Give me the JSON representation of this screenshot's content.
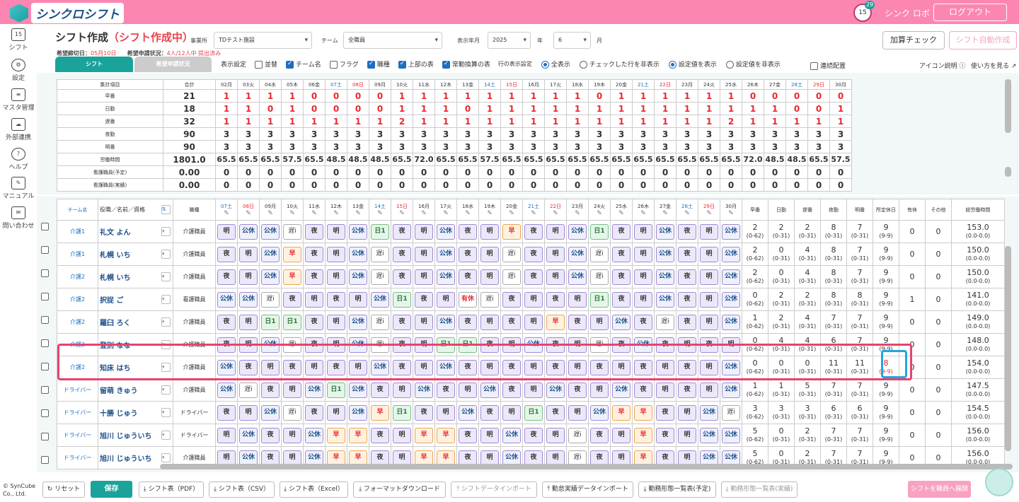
{
  "header": {
    "brand": "シンクロシフト",
    "calendar_badge": "29",
    "calendar_day": "15",
    "user": "シンク ロボ",
    "logout": "ログアウト"
  },
  "sidebar": [
    {
      "label": "シフト",
      "icon": "calendar-icon",
      "glyph": "15"
    },
    {
      "label": "設定",
      "icon": "gear-icon",
      "glyph": "⚙"
    },
    {
      "label": "マスタ管理",
      "icon": "database-icon",
      "glyph": "≡"
    },
    {
      "label": "外部連携",
      "icon": "cloud-sync-icon",
      "glyph": "☁"
    },
    {
      "label": "ヘルプ",
      "icon": "help-icon",
      "glyph": "?"
    },
    {
      "label": "マニュアル",
      "icon": "manual-icon",
      "glyph": "✎"
    },
    {
      "label": "問い合わせ",
      "icon": "mail-icon",
      "glyph": "✉"
    }
  ],
  "page": {
    "title": "シフト作成",
    "status": "（シフト作成中）",
    "deadline_label": "希望締切日：",
    "deadline": "05月10日",
    "req_label": "希望申請状況：",
    "req": "4人/12人中 提出済み"
  },
  "filters": {
    "office_label": "事業所",
    "office": "TDテスト施設",
    "team_label": "チーム",
    "team": "全職員",
    "ym_label": "表示年月",
    "year": "2025",
    "year_suffix": "年",
    "month": "6",
    "month_suffix": "月"
  },
  "actions": {
    "check": "加算チェック",
    "auto": "シフト自動作成"
  },
  "tabs": {
    "shift": "シフト",
    "request": "希望申請状況"
  },
  "display": {
    "label": "表示設定",
    "items": [
      {
        "t": "並替",
        "on": false
      },
      {
        "t": "チーム名",
        "on": true
      },
      {
        "t": "フラグ",
        "on": false
      },
      {
        "t": "職種",
        "on": true
      },
      {
        "t": "上部の表",
        "on": true
      },
      {
        "t": "常勤換算の表",
        "on": true
      }
    ],
    "row_label": "行の表示設定",
    "r1": "全表示",
    "r2": "チェックした行を非表示",
    "r3": "設定値を表示",
    "r4": "設定値を非表示",
    "consecutive": "連続配置",
    "icon_help": "アイコン説明",
    "how_to": "使い方を見る"
  },
  "summary": {
    "head_name": "集計項目",
    "head_total": "合計",
    "days": [
      "02月",
      "03火",
      "04水",
      "05木",
      "06金",
      "07土",
      "08日",
      "09月",
      "10火",
      "11水",
      "12木",
      "13金",
      "14土",
      "15日",
      "16月",
      "17火",
      "18水",
      "19木",
      "20金",
      "21土",
      "22日",
      "23月",
      "24火",
      "25水",
      "26木",
      "27金",
      "28土",
      "29日",
      "30月"
    ],
    "rows": [
      {
        "name": "早番",
        "total": "21",
        "v": [
          "1",
          "1",
          "1",
          "1",
          "0",
          "0",
          "0",
          "0",
          "1",
          "1",
          "1",
          "1",
          "1",
          "1",
          "1",
          "1",
          "1",
          "0",
          "1",
          "1",
          "1",
          "1",
          "1",
          "1",
          "0",
          "0",
          "0",
          "0",
          "0"
        ]
      },
      {
        "name": "日勤",
        "total": "18",
        "v": [
          "1",
          "1",
          "0",
          "1",
          "0",
          "0",
          "0",
          "0",
          "1",
          "1",
          "1",
          "0",
          "1",
          "1",
          "1",
          "1",
          "1",
          "1",
          "1",
          "1",
          "1",
          "1",
          "1",
          "1",
          "1",
          "1",
          "0",
          "0",
          "1"
        ]
      },
      {
        "name": "遅番",
        "total": "32",
        "v": [
          "1",
          "1",
          "1",
          "1",
          "1",
          "1",
          "1",
          "1",
          "2",
          "1",
          "1",
          "1",
          "1",
          "1",
          "1",
          "1",
          "1",
          "1",
          "1",
          "1",
          "1",
          "1",
          "1",
          "2",
          "1",
          "1",
          "1",
          "1",
          "1"
        ]
      },
      {
        "name": "夜勤",
        "total": "90",
        "v": [
          "3",
          "3",
          "3",
          "3",
          "3",
          "3",
          "3",
          "3",
          "3",
          "3",
          "3",
          "3",
          "3",
          "3",
          "3",
          "3",
          "3",
          "3",
          "3",
          "3",
          "3",
          "3",
          "3",
          "3",
          "3",
          "3",
          "3",
          "3",
          "3"
        ]
      },
      {
        "name": "明番",
        "total": "90",
        "v": [
          "3",
          "3",
          "3",
          "3",
          "3",
          "3",
          "3",
          "3",
          "3",
          "3",
          "3",
          "3",
          "3",
          "3",
          "3",
          "3",
          "3",
          "3",
          "3",
          "3",
          "3",
          "3",
          "3",
          "3",
          "3",
          "3",
          "3",
          "3",
          "3"
        ]
      },
      {
        "name": "労働時間",
        "total": "1801.0",
        "v": [
          "65.5",
          "65.5",
          "65.5",
          "57.5",
          "65.5",
          "48.5",
          "48.5",
          "48.5",
          "65.5",
          "72.0",
          "65.5",
          "65.5",
          "57.5",
          "65.5",
          "65.5",
          "65.5",
          "65.5",
          "65.5",
          "65.5",
          "65.5",
          "65.5",
          "65.5",
          "65.5",
          "65.5",
          "72.0",
          "48.5",
          "48.5",
          "65.5",
          "57.5",
          "48.5"
        ]
      },
      {
        "name": "看護職員(予定)",
        "total": "0.00",
        "v": [
          "0",
          "0",
          "0",
          "0",
          "0",
          "0",
          "0",
          "0",
          "0",
          "0",
          "0",
          "0",
          "0",
          "0",
          "0",
          "0",
          "0",
          "0",
          "0",
          "0",
          "0",
          "0",
          "0",
          "0",
          "0",
          "0",
          "0",
          "0",
          "0"
        ]
      },
      {
        "name": "看護職員(実績)",
        "total": "0.00",
        "v": [
          "0",
          "0",
          "0",
          "0",
          "0",
          "0",
          "0",
          "0",
          "0",
          "0",
          "0",
          "0",
          "0",
          "0",
          "0",
          "0",
          "0",
          "0",
          "0",
          "0",
          "0",
          "0",
          "0",
          "0",
          "0",
          "0",
          "0",
          "0",
          "0"
        ]
      }
    ]
  },
  "grid": {
    "head_team": "チーム名",
    "head_name": "役職／名前／資格",
    "head_role": "職種",
    "days": [
      "07土",
      "08日",
      "09月",
      "10火",
      "11水",
      "12木",
      "13金",
      "14土",
      "15日",
      "16月",
      "17火",
      "18水",
      "19木",
      "20金",
      "21土",
      "22日",
      "23月",
      "24火",
      "25水",
      "26木",
      "27金",
      "28土",
      "29日",
      "30月"
    ],
    "stat_heads": [
      "早番",
      "日勤",
      "遅番",
      "夜勤",
      "明番",
      "所定休日",
      "有休",
      "その他",
      "総労働時間"
    ],
    "rows": [
      {
        "team": "介護1",
        "name": "礼文 よん",
        "role": "介護職員",
        "s": [
          "明",
          "公休",
          "公休",
          "遅i",
          "夜",
          "明",
          "公休",
          "日1",
          "夜",
          "明",
          "公休",
          "夜",
          "明",
          "早",
          "夜",
          "明",
          "公休",
          "日1",
          "夜",
          "明",
          "公休",
          "夜",
          "明",
          "公休"
        ],
        "st": [
          [
            "2",
            "(0-62)"
          ],
          [
            "2",
            "(0-31)"
          ],
          [
            "2",
            "(0-31)"
          ],
          [
            "8",
            "(0-31)"
          ],
          [
            "7",
            "(0-31)"
          ],
          [
            "9",
            "(9-9)"
          ],
          [
            "0",
            ""
          ],
          [
            "0",
            ""
          ],
          [
            "153.0",
            "(0.0-0.0)"
          ]
        ]
      },
      {
        "team": "介護1",
        "name": "札幌 いち",
        "role": "介護職員",
        "s": [
          "夜",
          "明",
          "公休",
          "早",
          "夜",
          "明",
          "公休",
          "遅i",
          "夜",
          "明",
          "公休",
          "夜",
          "明",
          "遅i",
          "夜",
          "明",
          "公休",
          "遅i",
          "夜",
          "明",
          "公休",
          "夜",
          "明",
          "公休"
        ],
        "st": [
          [
            "2",
            "(0-62)"
          ],
          [
            "0",
            "(0-31)"
          ],
          [
            "4",
            "(0-31)"
          ],
          [
            "8",
            "(0-31)"
          ],
          [
            "7",
            "(0-31)"
          ],
          [
            "9",
            "(9-9)"
          ],
          [
            "0",
            ""
          ],
          [
            "0",
            ""
          ],
          [
            "150.0",
            "(0.0-0.0)"
          ]
        ]
      },
      {
        "team": "介護2",
        "name": "札幌 いち",
        "role": "介護職員",
        "s": [
          "夜",
          "明",
          "公休",
          "早",
          "夜",
          "明",
          "公休",
          "遅i",
          "夜",
          "明",
          "公休",
          "夜",
          "明",
          "遅i",
          "夜",
          "明",
          "公休",
          "遅i",
          "夜",
          "明",
          "公休",
          "夜",
          "明",
          "公休"
        ],
        "st": [
          [
            "2",
            "(0-62)"
          ],
          [
            "0",
            "(0-31)"
          ],
          [
            "4",
            "(0-31)"
          ],
          [
            "8",
            "(0-31)"
          ],
          [
            "7",
            "(0-31)"
          ],
          [
            "9",
            "(9-9)"
          ],
          [
            "0",
            ""
          ],
          [
            "0",
            ""
          ],
          [
            "150.0",
            "(0.0-0.0)"
          ]
        ]
      },
      {
        "team": "介護2",
        "name": "択捉 ご",
        "role": "看護職員",
        "s": [
          "公休",
          "公休",
          "遅i",
          "夜",
          "明",
          "夜",
          "明",
          "公休",
          "日1",
          "夜",
          "明",
          "有休",
          "遅i",
          "夜",
          "明",
          "夜",
          "明",
          "日1",
          "夜",
          "明",
          "公休",
          "夜",
          "明",
          "公休"
        ],
        "st": [
          [
            "0",
            "(0-62)"
          ],
          [
            "2",
            "(0-31)"
          ],
          [
            "2",
            "(0-31)"
          ],
          [
            "8",
            "(0-31)"
          ],
          [
            "8",
            "(0-31)"
          ],
          [
            "9",
            "(9-9)"
          ],
          [
            "1",
            ""
          ],
          [
            "0",
            ""
          ],
          [
            "141.0",
            "(0.0-0.0)"
          ]
        ]
      },
      {
        "team": "介護2",
        "name": "羅臼 ろく",
        "role": "介護職員",
        "s": [
          "夜",
          "明",
          "日1",
          "日1",
          "夜",
          "明",
          "公休",
          "遅i",
          "夜",
          "明",
          "公休",
          "夜",
          "明",
          "夜",
          "明",
          "早",
          "夜",
          "明",
          "公休",
          "夜",
          "遅i",
          "夜",
          "明",
          "公休"
        ],
        "st": [
          [
            "1",
            "(0-62)"
          ],
          [
            "2",
            "(0-31)"
          ],
          [
            "4",
            "(0-31)"
          ],
          [
            "7",
            "(0-31)"
          ],
          [
            "7",
            "(0-31)"
          ],
          [
            "9",
            "(9-9)"
          ],
          [
            "0",
            ""
          ],
          [
            "0",
            ""
          ],
          [
            "149.0",
            "(0.0-0.0)"
          ]
        ]
      },
      {
        "team": "介護2",
        "name": "登別 なな",
        "role": "介護職員",
        "s": [
          "夜",
          "明",
          "公休",
          "遅i",
          "夜",
          "明",
          "公休",
          "遅i",
          "夜",
          "明",
          "日1",
          "日1",
          "夜",
          "明",
          "公休",
          "夜",
          "明",
          "遅i",
          "夜",
          "公休",
          "夜",
          "明",
          "夜",
          "明"
        ],
        "st": [
          [
            "0",
            "(0-62)"
          ],
          [
            "4",
            "(0-31)"
          ],
          [
            "4",
            "(0-31)"
          ],
          [
            "6",
            "(0-31)"
          ],
          [
            "7",
            "(0-31)"
          ],
          [
            "9",
            "(9-9)"
          ],
          [
            "0",
            ""
          ],
          [
            "0",
            ""
          ],
          [
            "148.0",
            "(0.0-0.0)"
          ]
        ]
      },
      {
        "team": "介護2",
        "name": "知床 はち",
        "role": "介護職員",
        "s": [
          "公休",
          "夜",
          "明",
          "夜",
          "明",
          "夜",
          "明",
          "公休",
          "夜",
          "明",
          "公休",
          "夜",
          "明",
          "夜",
          "明",
          "夜",
          "明",
          "夜",
          "明",
          "夜",
          "明",
          "夜",
          "明",
          "公休"
        ],
        "st": [
          [
            "0",
            "(0-62)"
          ],
          [
            "0",
            "(0-31)"
          ],
          [
            "0",
            "(0-31)"
          ],
          [
            "11",
            "(0-31)"
          ],
          [
            "11",
            "(0-31)"
          ],
          [
            "8",
            "(9-9)"
          ],
          [
            "0",
            ""
          ],
          [
            "0",
            ""
          ],
          [
            "154.0",
            "(0.0-0.0)"
          ]
        ],
        "hl": true
      },
      {
        "team": "ドライバー",
        "name": "留萌 きゅう",
        "role": "介護職員",
        "s": [
          "公休",
          "遅i",
          "夜",
          "明",
          "公休",
          "日1",
          "公休",
          "夜",
          "明",
          "公休",
          "夜",
          "明",
          "公休",
          "夜",
          "明",
          "公休",
          "夜",
          "明",
          "公休",
          "夜",
          "明",
          "夜",
          "明",
          "公休"
        ],
        "st": [
          [
            "1",
            "(0-62)"
          ],
          [
            "1",
            "(0-31)"
          ],
          [
            "5",
            "(0-31)"
          ],
          [
            "7",
            "(0-31)"
          ],
          [
            "7",
            "(0-31)"
          ],
          [
            "9",
            "(9-9)"
          ],
          [
            "0",
            ""
          ],
          [
            "0",
            ""
          ],
          [
            "147.5",
            "(0.0-0.0)"
          ]
        ]
      },
      {
        "team": "ドライバー",
        "name": "十勝 じゅう",
        "role": "ドライバー",
        "s": [
          "夜",
          "明",
          "公休",
          "遅i",
          "夜",
          "明",
          "公休",
          "早",
          "日1",
          "夜",
          "明",
          "公休",
          "夜",
          "明",
          "日1",
          "夜",
          "明",
          "公休",
          "早",
          "早",
          "夜",
          "明",
          "公休",
          "遅i"
        ],
        "st": [
          [
            "3",
            "(0-62)"
          ],
          [
            "3",
            "(0-31)"
          ],
          [
            "3",
            "(0-31)"
          ],
          [
            "6",
            "(0-31)"
          ],
          [
            "6",
            "(0-31)"
          ],
          [
            "9",
            "(9-9)"
          ],
          [
            "0",
            ""
          ],
          [
            "0",
            ""
          ],
          [
            "154.5",
            "(0.0-0.0)"
          ]
        ]
      },
      {
        "team": "ドライバー",
        "name": "旭川 じゅういち",
        "role": "ドライバー",
        "s": [
          "明",
          "公休",
          "夜",
          "明",
          "公休",
          "早",
          "早",
          "夜",
          "明",
          "早",
          "早",
          "夜",
          "明",
          "公休",
          "夜",
          "明",
          "遅i",
          "夜",
          "明",
          "早",
          "夜",
          "明",
          "公休",
          "公休"
        ],
        "st": [
          [
            "5",
            "(0-62)"
          ],
          [
            "0",
            "(0-31)"
          ],
          [
            "2",
            "(0-31)"
          ],
          [
            "7",
            "(0-31)"
          ],
          [
            "7",
            "(0-31)"
          ],
          [
            "9",
            "(9-9)"
          ],
          [
            "0",
            ""
          ],
          [
            "0",
            ""
          ],
          [
            "156.0",
            "(0.0-0.0)"
          ]
        ]
      },
      {
        "team": "ドライバー",
        "name": "旭川 じゅういち",
        "role": "介護職員",
        "s": [
          "明",
          "公休",
          "夜",
          "明",
          "公休",
          "早",
          "早",
          "夜",
          "明",
          "早",
          "早",
          "夜",
          "明",
          "公休",
          "夜",
          "明",
          "遅i",
          "夜",
          "明",
          "早",
          "夜",
          "明",
          "公休",
          "公休"
        ],
        "st": [
          [
            "5",
            "(0-62)"
          ],
          [
            "0",
            "(0-31)"
          ],
          [
            "2",
            "(0-31)"
          ],
          [
            "7",
            "(0-31)"
          ],
          [
            "7",
            "(0-31)"
          ],
          [
            "9",
            "(9-9)"
          ],
          [
            "0",
            ""
          ],
          [
            "0",
            ""
          ],
          [
            "156.0",
            "(0.0-0.0)"
          ]
        ]
      }
    ]
  },
  "footer": {
    "reset": "リセット",
    "save": "保存",
    "pdf": "シフト表（PDF）",
    "csv": "シフト表（CSV）",
    "excel": "シフト表（Excel）",
    "format": "フォーマットダウンロード",
    "import": "シフトデータインポート",
    "att_import": "勤怠実績データインポート",
    "plan": "勤務形態一覧表(予定)",
    "actual": "勤務形態一覧表(実績)",
    "publish": "シフトを職員へ展開",
    "copyright1": "© SynCube",
    "copyright2": "Co., Ltd."
  }
}
